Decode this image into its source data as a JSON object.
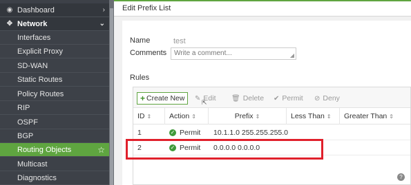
{
  "sidebar": {
    "top_items": [
      {
        "label": "Dashboard",
        "icon": "dashboard-icon",
        "chevron": "›"
      },
      {
        "label": "Network",
        "icon": "network-icon",
        "chevron": "⌄"
      }
    ],
    "sub_items": [
      {
        "label": "Interfaces"
      },
      {
        "label": "Explicit Proxy"
      },
      {
        "label": "SD-WAN"
      },
      {
        "label": "Static Routes"
      },
      {
        "label": "Policy Routes"
      },
      {
        "label": "RIP"
      },
      {
        "label": "OSPF"
      },
      {
        "label": "BGP"
      },
      {
        "label": "Routing Objects",
        "active": true
      },
      {
        "label": "Multicast"
      },
      {
        "label": "Diagnostics"
      }
    ],
    "accent_color": "#5fa540"
  },
  "header": {
    "title": "Edit Prefix List"
  },
  "form": {
    "name_label": "Name",
    "name_value": "test",
    "comments_label": "Comments",
    "comments_placeholder": "Write a comment..."
  },
  "rules": {
    "label": "Rules",
    "toolbar": {
      "create": "Create New",
      "edit": "Edit",
      "delete": "Delete",
      "permit": "Permit",
      "deny": "Deny"
    },
    "columns": [
      "ID",
      "Action",
      "Prefix",
      "Less Than",
      "Greater Than"
    ],
    "rows": [
      {
        "id": "1",
        "action": "Permit",
        "prefix": "10.1.1.0 255.255.255.0",
        "less_than": "",
        "greater_than": ""
      },
      {
        "id": "2",
        "action": "Permit",
        "prefix": "0.0.0.0 0.0.0.0",
        "less_than": "",
        "greater_than": ""
      }
    ]
  },
  "highlight_color": "#e0202b"
}
